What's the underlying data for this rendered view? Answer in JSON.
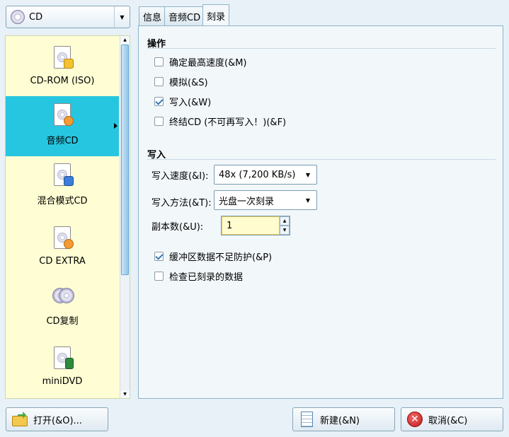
{
  "disc_select": {
    "value": "CD",
    "icon": "cd-disc-icon"
  },
  "projects": [
    {
      "label": "CD-ROM (ISO)",
      "icon": "cd-rom-project-icon",
      "active": false
    },
    {
      "label": "音频CD",
      "icon": "audio-cd-project-icon",
      "active": true
    },
    {
      "label": "混合模式CD",
      "icon": "mixed-mode-cd-project-icon",
      "active": false
    },
    {
      "label": "CD EXTRA",
      "icon": "cd-extra-project-icon",
      "active": false
    },
    {
      "label": "CD复制",
      "icon": "cd-copy-project-icon",
      "active": false
    },
    {
      "label": "miniDVD",
      "icon": "minidvd-project-icon",
      "active": false
    }
  ],
  "tabs": [
    {
      "label": "信息",
      "active": false
    },
    {
      "label": "音频CD",
      "active": false
    },
    {
      "label": "刻录",
      "active": true
    }
  ],
  "burn_tab": {
    "operations_title": "操作",
    "operations": [
      {
        "label": "确定最高速度(&M)",
        "checked": false
      },
      {
        "label": "模拟(&S)",
        "checked": false
      },
      {
        "label": "写入(&W)",
        "checked": true
      },
      {
        "label": "终结CD (不可再写入！)(&F)",
        "checked": false
      }
    ],
    "write_title": "写入",
    "write_speed_label": "写入速度(&I):",
    "write_speed_value": "48x (7,200 KB/s)",
    "write_method_label": "写入方法(&T):",
    "write_method_value": "光盘一次刻录",
    "copies_label": "副本数(&U):",
    "copies_value": "1",
    "options": [
      {
        "label": "缓冲区数据不足防护(&P)",
        "checked": true
      },
      {
        "label": "检查已刻录的数据",
        "checked": false
      }
    ]
  },
  "buttons": {
    "open": "打开(&O)...",
    "new": "新建(&N)",
    "cancel": "取消(&C)"
  },
  "colors": {
    "window_bg": "#e7f1f7",
    "list_bg": "#fffdd3",
    "selection": "#26c6e0"
  }
}
